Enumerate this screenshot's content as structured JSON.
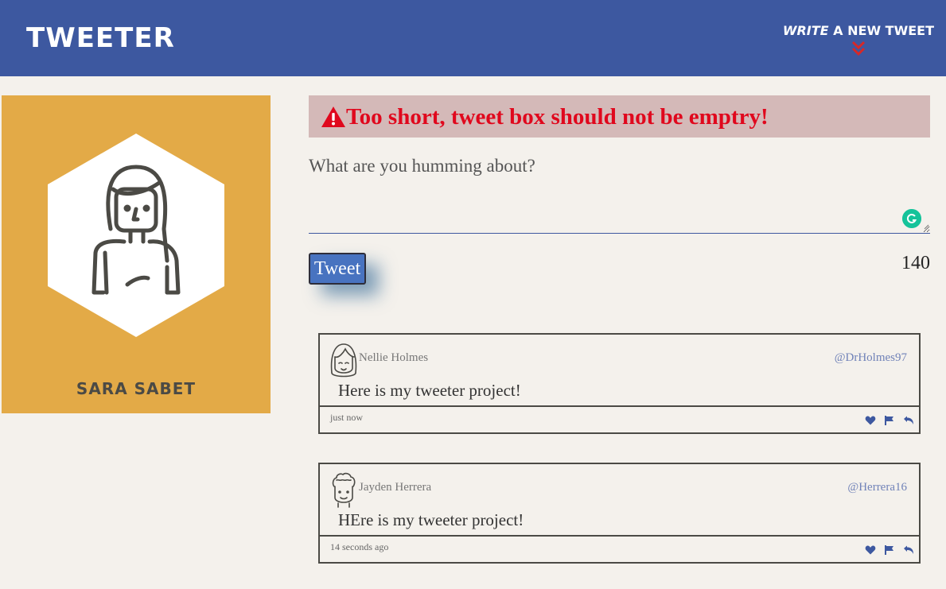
{
  "nav": {
    "brand": "TWEETER",
    "compose_word1": "WRITE",
    "compose_rest": " A NEW TWEET"
  },
  "profile": {
    "name": "SARA SABET"
  },
  "error": {
    "message": "Too short, tweet box should not be emptry!"
  },
  "form": {
    "placeholder": "What are you humming about?",
    "button_label": "Tweet",
    "counter": "140"
  },
  "tweets": [
    {
      "name": "Nellie Holmes",
      "handle": "@DrHolmes97",
      "content": "Here is my tweeter project!",
      "time": "just now"
    },
    {
      "name": "Jayden Herrera",
      "handle": "@Herrera16",
      "content": "HEre is my tweeter project!",
      "time": "14 seconds ago"
    }
  ],
  "colors": {
    "nav_bg": "#3d58a0",
    "profile_bg": "#e3aa47",
    "error_text": "#e0081d",
    "icon_blue": "#3d58a0"
  }
}
